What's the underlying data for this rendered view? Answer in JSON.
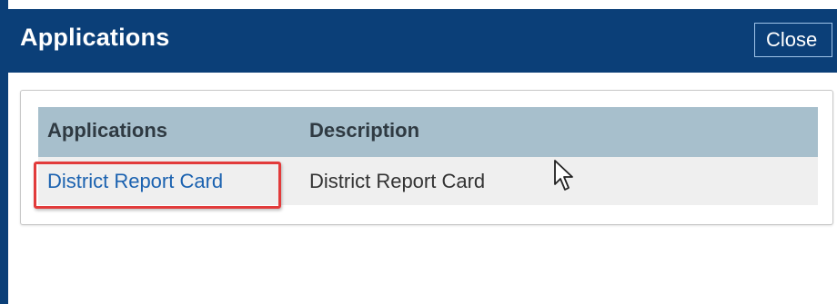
{
  "dialog": {
    "title": "Applications",
    "close_label": "Close"
  },
  "table": {
    "columns": [
      "Applications",
      "Description"
    ],
    "rows": [
      {
        "application": "District Report Card",
        "description": "District Report Card"
      }
    ]
  },
  "colors": {
    "titlebar": "#0b3f78",
    "header_row": "#a7bfcc",
    "link": "#1b62b0",
    "highlight": "#e23b3b"
  },
  "icons": {
    "cursor": "mouse-pointer-icon"
  }
}
